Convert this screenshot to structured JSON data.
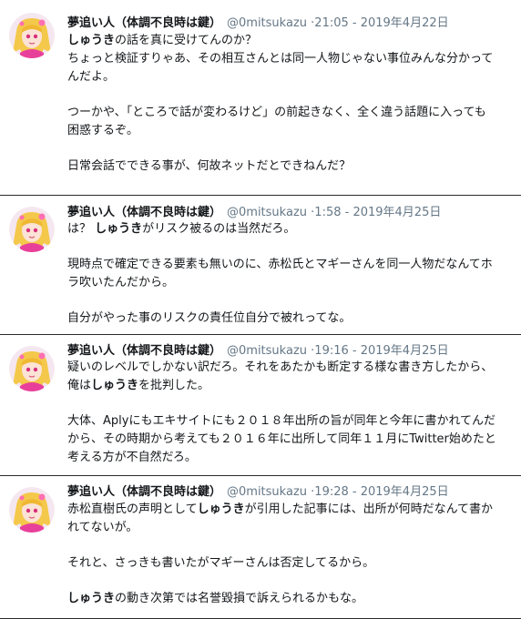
{
  "tweets": [
    {
      "name": "夢追い人（体調不良時は鍵）",
      "handle": "@0mitsukazu",
      "separator": "·",
      "time": "21:05 - 2019年4月22日",
      "paragraphs": [
        [
          {
            "t": "しゅうき",
            "b": true
          },
          {
            "t": "の話を真に受けてんのか？"
          }
        ],
        [
          {
            "t": "ちょっと検証すりゃあ、その相互さんとは同一人物じゃない事位みんな分かって"
          }
        ],
        [
          {
            "t": "んだよ。"
          }
        ],
        null,
        [
          {
            "t": "つーかや、「ところで話が変わるけど」の前起きなく、全く違う話題に入っても"
          }
        ],
        [
          {
            "t": "困惑するぞ。"
          }
        ],
        null,
        [
          {
            "t": "日常会話でできる事が、何故ネットだとできねんだ？"
          }
        ]
      ]
    },
    {
      "name": "夢追い人（体調不良時は鍵）",
      "handle": "@0mitsukazu",
      "separator": "·",
      "time": "1:58 - 2019年4月25日",
      "paragraphs": [
        [
          {
            "t": "は？ "
          },
          {
            "t": "しゅうき",
            "b": true
          },
          {
            "t": "がリスク被るのは当然だろ。"
          }
        ],
        null,
        [
          {
            "t": "現時点で確定できる要素も無いのに、赤松氏とマギーさんを同一人物だなんてホ"
          }
        ],
        [
          {
            "t": "ラ吹いたんだから。"
          }
        ],
        null,
        [
          {
            "t": "自分がやった事のリスクの責任位自分で被れってな。"
          }
        ]
      ]
    },
    {
      "name": "夢追い人（体調不良時は鍵）",
      "handle": "@0mitsukazu",
      "separator": "·",
      "time": "19:16 - 2019年4月25日",
      "paragraphs": [
        [
          {
            "t": "疑いのレベルでしかない訳だろ。それをあたかも断定する様な書き方したから、"
          }
        ],
        [
          {
            "t": "俺は"
          },
          {
            "t": "しゅうき",
            "b": true
          },
          {
            "t": "を批判した。"
          }
        ],
        null,
        [
          {
            "t": "大体、Aplyにもエキサイトにも２０１８年出所の旨が同年と今年に書かれてんだ"
          }
        ],
        [
          {
            "t": "から、その時期から考えても２０１６年に出所して同年１１月にTwitter始めたと"
          }
        ],
        [
          {
            "t": "考える方が不自然だろ。"
          }
        ]
      ]
    },
    {
      "name": "夢追い人（体調不良時は鍵）",
      "handle": "@0mitsukazu",
      "separator": "·",
      "time": "19:28 - 2019年4月25日",
      "paragraphs": [
        [
          {
            "t": "赤松直樹氏の声明として"
          },
          {
            "t": "しゅうき",
            "b": true
          },
          {
            "t": "が引用した記事には、出所が何時だなんて書か"
          }
        ],
        [
          {
            "t": "れてないが。"
          }
        ],
        null,
        [
          {
            "t": "それと、さっきも書いたがマギーさんは否定してるから。"
          }
        ],
        null,
        [
          {
            "t": "しゅうき",
            "b": true
          },
          {
            "t": "の動き次第では名誉毀損で訴えられるかもな。"
          }
        ]
      ]
    }
  ],
  "colors": {
    "text": "#14171a",
    "muted": "#657786",
    "divider": "#2a2a2a"
  },
  "icons": {
    "avatar": "anime-character-avatar"
  }
}
